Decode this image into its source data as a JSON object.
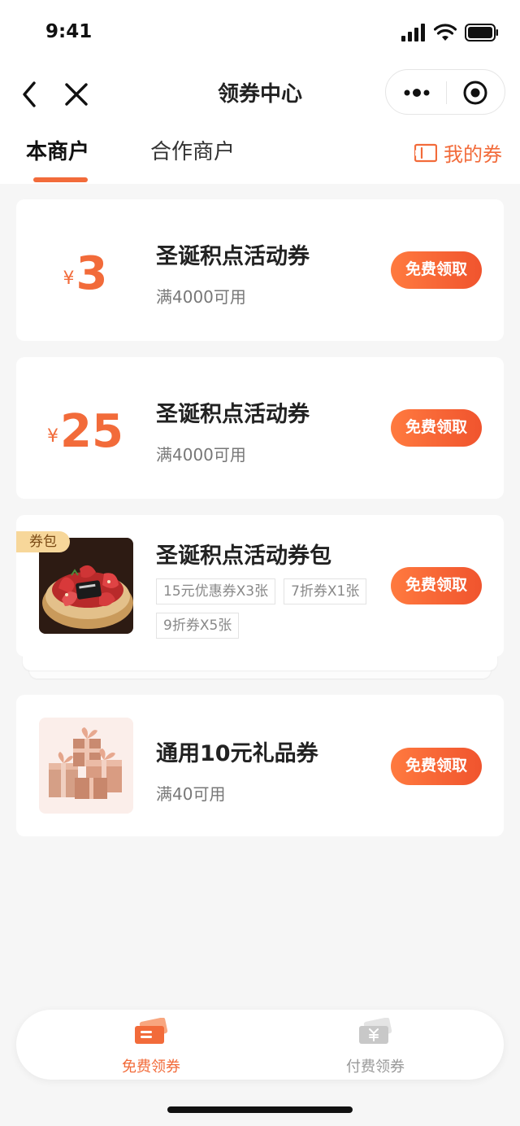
{
  "status_bar": {
    "time": "9:41"
  },
  "navbar": {
    "title": "领券中心"
  },
  "tabs": [
    {
      "label": "本商户",
      "active": true
    },
    {
      "label": "合作商户",
      "active": false
    }
  ],
  "my_coupons": {
    "label": "我的券"
  },
  "coupons": [
    {
      "currency": "¥",
      "amount": "3",
      "title": "圣诞积点活动券",
      "condition": "满4000可用",
      "button": "免费领取"
    },
    {
      "currency": "¥",
      "amount": "25",
      "title": "圣诞积点活动券",
      "condition": "满4000可用",
      "button": "免费领取"
    },
    {
      "badge": "券包",
      "image": "strawberry-tart",
      "title": "圣诞积点活动券包",
      "tags": [
        "15元优惠券X3张",
        "7折券X1张",
        "9折券X5张"
      ],
      "button": "免费领取"
    },
    {
      "image": "gift-boxes",
      "title": "通用10元礼品券",
      "condition": "满40可用",
      "button": "免费领取"
    }
  ],
  "bottom_tabs": [
    {
      "label": "免费领券",
      "icon": "free-ticket-icon",
      "active": true
    },
    {
      "label": "付费领券",
      "icon": "paid-ticket-icon",
      "active": false
    }
  ],
  "colors": {
    "accent": "#f26b3a",
    "badge": "#f7d79a",
    "background": "#f6f6f6"
  }
}
